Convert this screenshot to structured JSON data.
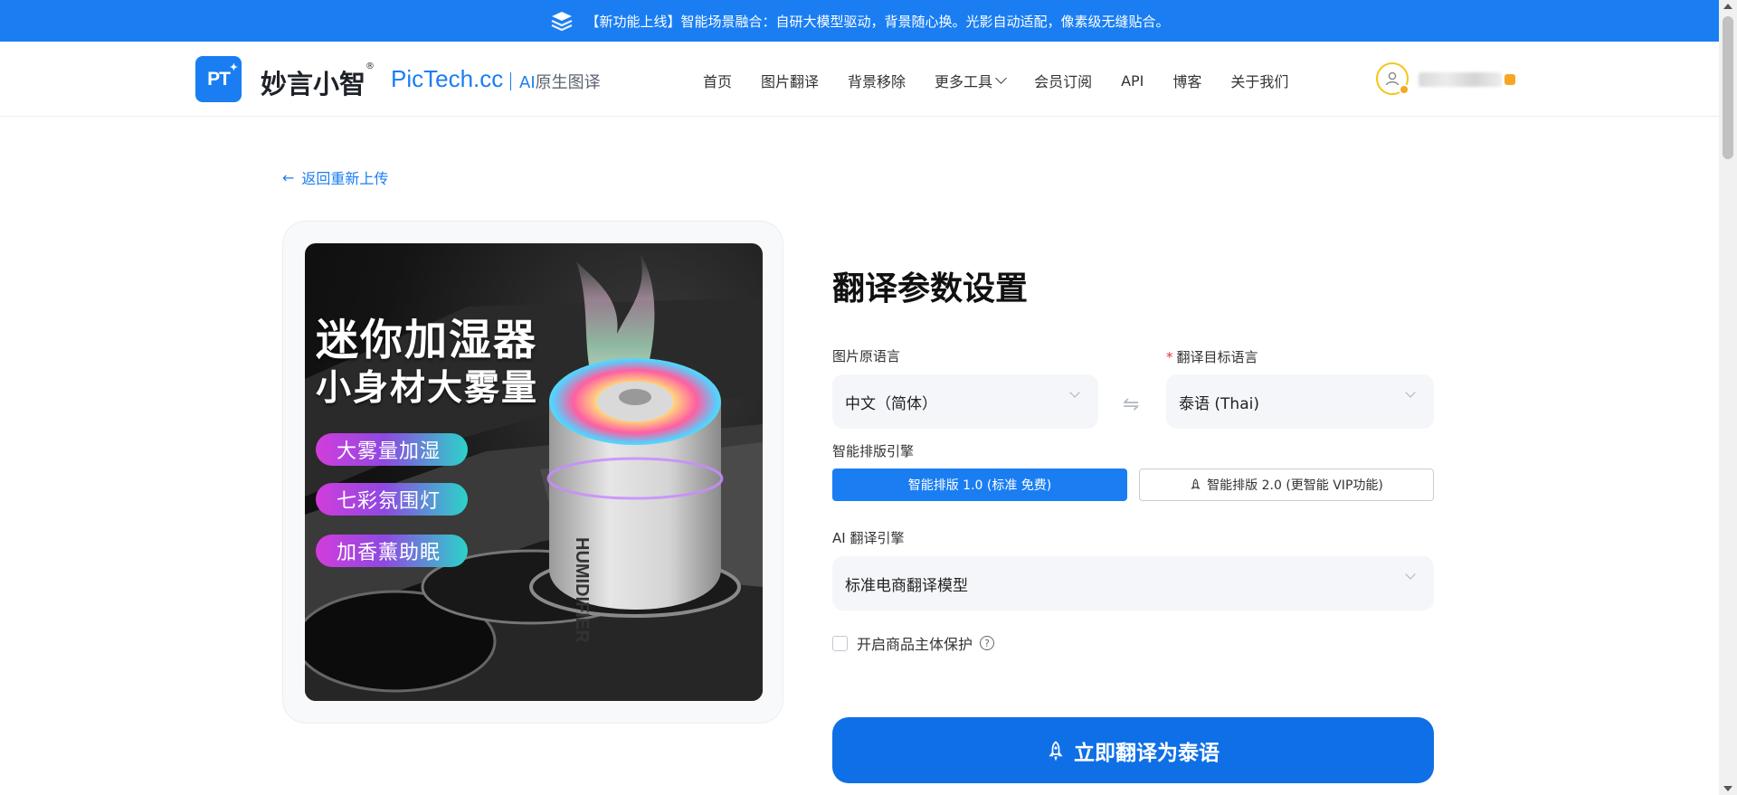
{
  "banner": {
    "text": "【新功能上线】智能场景融合：自研大模型驱动，背景随心换。光影自动适配，像素级无缝贴合。",
    "icon": "layers-icon"
  },
  "header": {
    "logo_text": "PT",
    "brand_cn": "妙言小智",
    "brand_reg": "®",
    "brand_en": "PicTech.cc",
    "brand_sub_ai": "AI",
    "brand_sub_rest": "原生图译",
    "nav": [
      {
        "label": "首页"
      },
      {
        "label": "图片翻译"
      },
      {
        "label": "背景移除"
      },
      {
        "label": "更多工具"
      },
      {
        "label": "会员订阅"
      },
      {
        "label": "API"
      },
      {
        "label": "博客"
      },
      {
        "label": "关于我们"
      }
    ]
  },
  "back_link": "返回重新上传",
  "product_image": {
    "title": "迷你加湿器",
    "subtitle": "小身材大雾量",
    "features": [
      "大雾量加湿",
      "七彩氛围灯",
      "加香薰助眠"
    ],
    "device_text": "HUMIDIFIER"
  },
  "settings": {
    "title": "翻译参数设置",
    "source_lang_label": "图片原语言",
    "source_lang_value": "中文（简体）",
    "target_lang_required": "*",
    "target_lang_label": "翻译目标语言",
    "target_lang_value": "泰语 (Thai)",
    "swap_symbol": "⇋",
    "layout_engine_label": "智能排版引擎",
    "engine_v1": "智能排版 1.0 (标准 免费)",
    "engine_v2": "智能排版 2.0 (更智能 VIP功能)",
    "ai_engine_label": "AI 翻译引擎",
    "ai_engine_value": "标准电商翻译模型",
    "protect_label": "开启商品主体保护",
    "help_symbol": "?",
    "cta_label": "立即翻译为泰语"
  },
  "colors": {
    "brand_blue": "#1a7ef2",
    "cta_blue": "#0f6fe6",
    "required_red": "#e5383b"
  }
}
